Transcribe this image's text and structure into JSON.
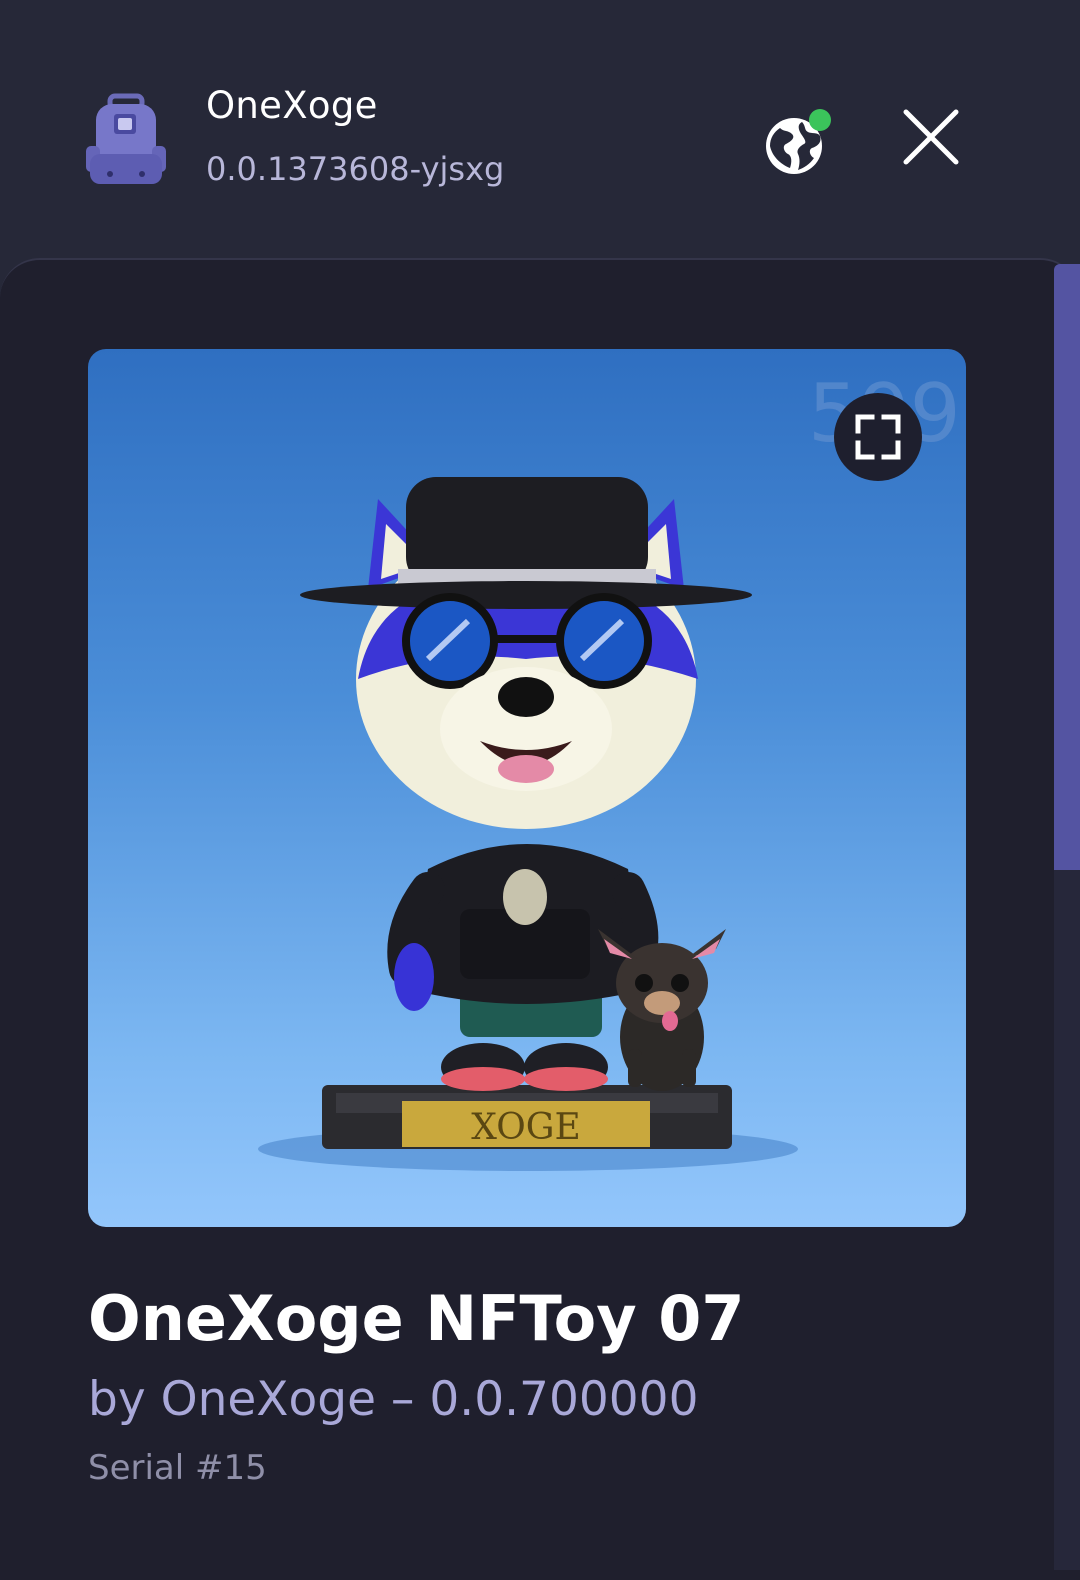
{
  "header": {
    "app_name": "OneXoge",
    "account_id": "0.0.1373608-yjsxg",
    "app_icon": "backpack-icon",
    "network_icon": "globe-icon",
    "network_status_color": "#3bc45b",
    "close_icon": "close-icon"
  },
  "nft": {
    "watermark_number": "599",
    "plaque_text": "XOGE",
    "expand_icon": "fullscreen-icon",
    "title": "OneXoge NFToy 07",
    "byline": "by OneXoge – 0.0.700000",
    "serial": "Serial #15"
  },
  "colors": {
    "background": "#262838",
    "panel": "#1f1f2d",
    "accent": "#5454a2",
    "byline": "#a9a8d8"
  }
}
